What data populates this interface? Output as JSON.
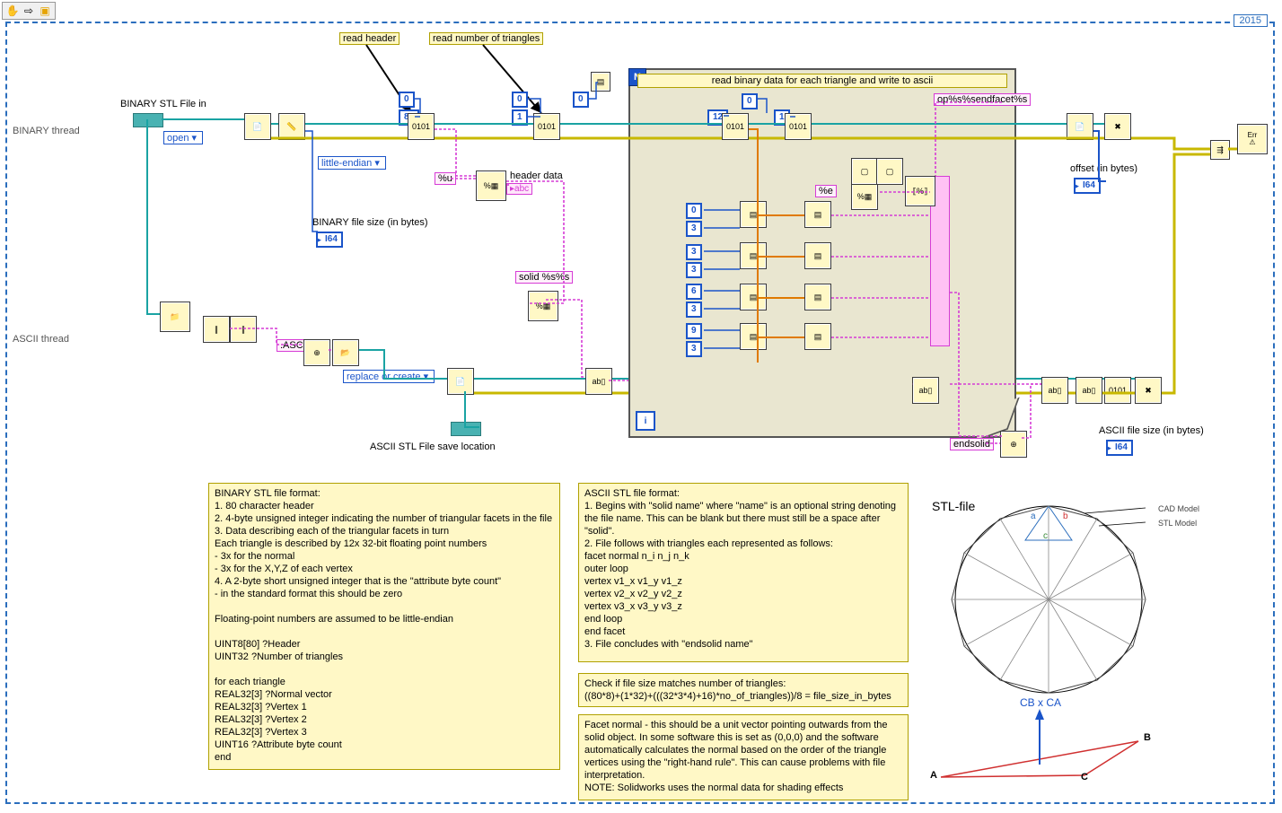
{
  "toolbar": {
    "hand": "✋",
    "arrow_right": "⇨",
    "port": "▣"
  },
  "year": "2015",
  "labels": {
    "read_header": "read header",
    "read_num_tri": "read number of triangles",
    "binary_thread": "BINARY thread",
    "binary_file_in": "BINARY STL File in",
    "ascii_thread": "ASCII thread",
    "open": "open",
    "little_endian": "little-endian",
    "replace_or_create": "replace or create",
    "header_data": "header data",
    "binary_size": "BINARY file size (in bytes)",
    "ascii_save_loc": "ASCII STL File save location",
    "offset": "offset (in bytes)",
    "ascii_size": "ASCII file size (in bytes)",
    "i64": "I64",
    "ascii": ".ASCII",
    "solid_fmt": "solid %s%s",
    "endfacet_fmt": "op%s%sendfacet%s",
    "endsolid": "endsolid",
    "pct_u": "%u",
    "pct_e": "%e",
    "c_0": "0",
    "c_1": "1",
    "c_3": "3",
    "c_6": "6",
    "c_9": "9",
    "c_12": "12",
    "c_80": "80",
    "abc": "▸abc"
  },
  "loop": {
    "title": "read binary data for each triangle and write to ascii",
    "n": "N",
    "i": "i"
  },
  "error": {
    "caption": "Error"
  },
  "docs": {
    "binary_fmt": "BINARY STL file format:\n1. 80 character header\n2. 4-byte unsigned integer indicating the number of triangular facets in the file\n3. Data describing each of the triangular facets in turn\nEach triangle is described by 12x 32-bit floating point numbers\n- 3x for the normal\n- 3x for the X,Y,Z of each vertex\n4. A 2-byte short unsigned integer that is the \"attribute byte count\"\n- in the standard format this should be zero\n\nFloating-point numbers are assumed to be little-endian\n\nUINT8[80] ?Header\nUINT32 ?Number of triangles\n\nfor each triangle\nREAL32[3] ?Normal vector\nREAL32[3] ?Vertex 1\nREAL32[3] ?Vertex 2\nREAL32[3] ?Vertex 3\nUINT16 ?Attribute byte count\nend",
    "ascii_fmt": "ASCII STL file format:\n1. Begins with \"solid name\" where \"name\" is an optional string denoting the file name. This can be blank but there must still be a space after \"solid\".\n2. File follows with triangles each represented as follows:\nfacet normal n_i n_j n_k\nouter loop\nvertex v1_x v1_y v1_z\nvertex v2_x v2_y v2_z\nvertex v3_x v3_y v3_z\nend loop\nend facet\n3. File concludes with \"endsolid name\"",
    "check": "Check if file size matches number of triangles:\n((80*8)+(1*32)+(((32*3*4)+16)*no_of_triangles))/8 = file_size_in_bytes",
    "facet_normal": "Facet normal - this should be a unit vector pointing outwards from the solid object. In some software this is set as (0,0,0) and the software automatically calculates the normal based on the order of the triangle vertices using the \"right-hand rule\". This can cause problems with file interpretation.\nNOTE: Solidworks uses the normal data for shading effects"
  },
  "stl_diagram": {
    "title": "STL-file",
    "cad_caption": "CAD Model",
    "stl_caption": "STL Model",
    "a": "a",
    "b": "b",
    "c": "c",
    "formula": "CB x CA",
    "tri_a": "A",
    "tri_b": "B",
    "tri_c": "C"
  }
}
